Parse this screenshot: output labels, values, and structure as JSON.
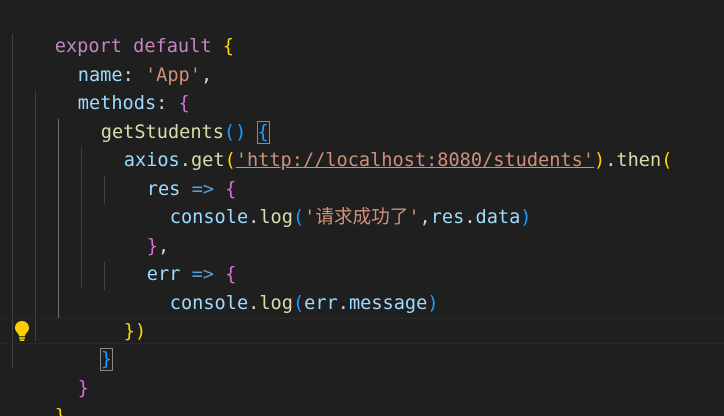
{
  "editor": {
    "lines": [
      {
        "t": [
          "export",
          " ",
          "default",
          " ",
          "{"
        ]
      },
      {
        "t": [
          "name",
          ": ",
          "'App'",
          ","
        ]
      },
      {
        "t": [
          "methods",
          ": ",
          "{"
        ]
      },
      {
        "t": [
          "getStudents",
          "()",
          " ",
          "{"
        ]
      },
      {
        "t": [
          "axios",
          ".",
          "get",
          "(",
          "'http://localhost:8080/students'",
          ")",
          ".",
          "then",
          "("
        ]
      },
      {
        "t": [
          "res",
          " => ",
          "{"
        ]
      },
      {
        "t": [
          "console",
          ".",
          "log",
          "(",
          "'请求成功了'",
          ",",
          "res",
          ".",
          "data",
          ")"
        ]
      },
      {
        "t": [
          "}",
          ","
        ]
      },
      {
        "t": [
          "err",
          " => ",
          "{"
        ]
      },
      {
        "t": [
          "console",
          ".",
          "log",
          "(",
          "err",
          ".",
          "message",
          ")"
        ]
      },
      {
        "t": [
          "})"
        ]
      },
      {
        "t": [
          "}"
        ]
      },
      {
        "t": [
          "}"
        ]
      },
      {
        "t": [
          "}"
        ]
      }
    ]
  },
  "icons": {
    "lightbulb": "lightbulb-icon"
  },
  "colors": {
    "background": "#1f1f1f",
    "keyword": "#569cd6",
    "control_keyword": "#c586c0",
    "property": "#9cdcfe",
    "function": "#dcdcaa",
    "string": "#ce9178",
    "bracket_level1": "#ffd700",
    "bracket_level2": "#da70d6",
    "bracket_level3": "#179fff",
    "lightbulb": "#ffcc00"
  }
}
